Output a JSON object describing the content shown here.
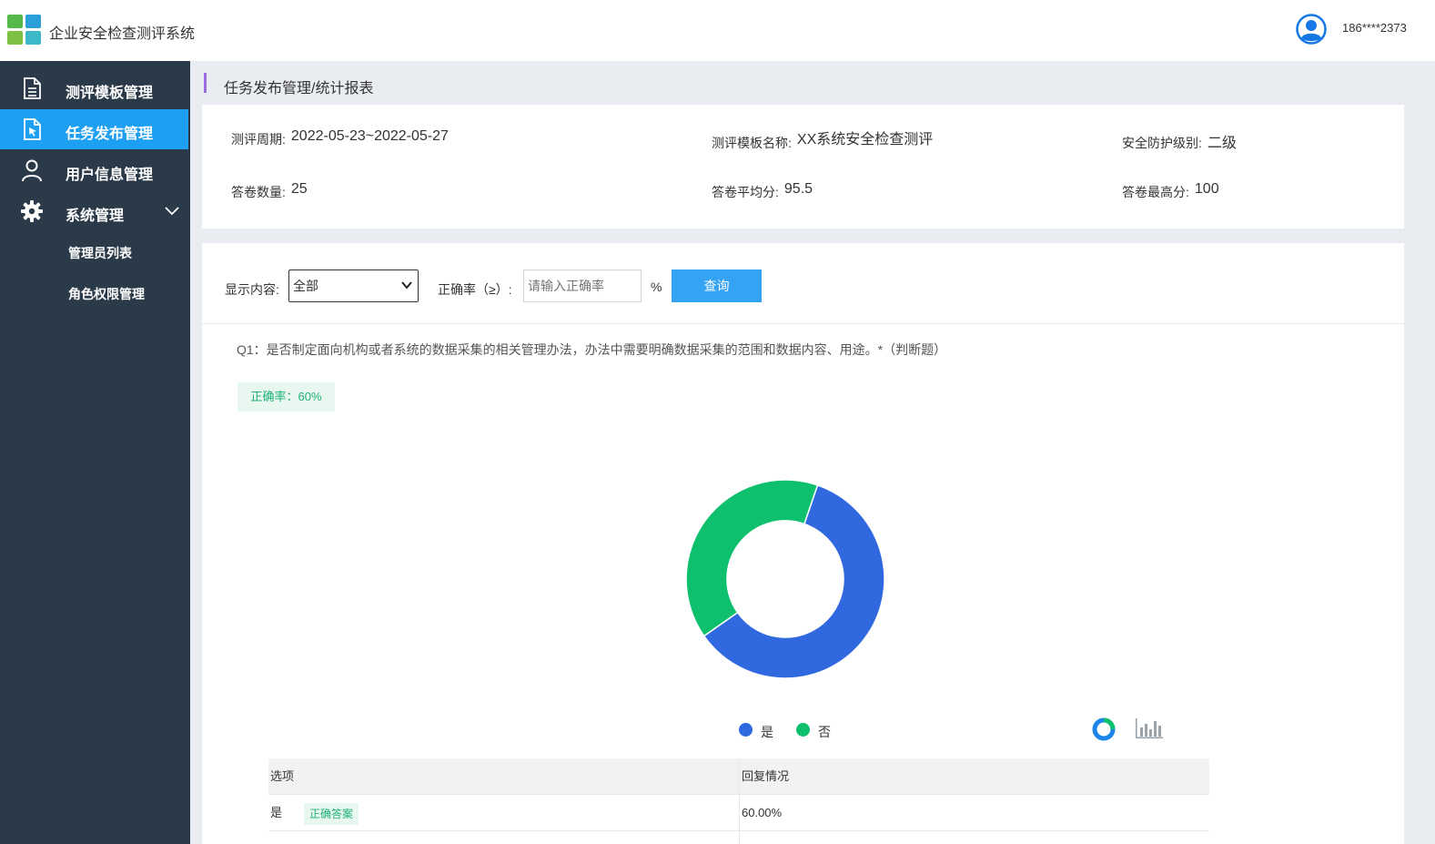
{
  "app": {
    "title": "企业安全检查测评系统"
  },
  "user": {
    "name": "186****2373"
  },
  "sidebar": {
    "items": [
      {
        "label": "测评模板管理"
      },
      {
        "label": "任务发布管理"
      },
      {
        "label": "用户信息管理"
      },
      {
        "label": "系统管理"
      }
    ],
    "sub_items": [
      {
        "label": "管理员列表"
      },
      {
        "label": "角色权限管理"
      }
    ]
  },
  "breadcrumb": {
    "text": "任务发布管理/统计报表"
  },
  "info": {
    "period": {
      "key": "测评周期:",
      "value": "2022-05-23~2022-05-27"
    },
    "template": {
      "key": "测评模板名称:",
      "value": "XX系统安全检查测评"
    },
    "level": {
      "key": "安全防护级别:",
      "value": "二级"
    },
    "count": {
      "key": "答卷数量:",
      "value": "25"
    },
    "avg": {
      "key": "答卷平均分:",
      "value": "95.5"
    },
    "max": {
      "key": "答卷最高分:",
      "value": "100"
    }
  },
  "filter": {
    "display_label": "显示内容:",
    "display_value": "全部",
    "rate_label": "正确率（≥）:",
    "rate_placeholder": "请输入正确率",
    "rate_unit": "%",
    "query_label": "查询"
  },
  "question": {
    "text": "Q1：是否制定面向机构或者系统的数据采集的相关管理办法，办法中需要明确数据采集的范围和数据内容、用途。*（判断题）",
    "accuracy": "正确率：60%"
  },
  "chart_data": {
    "type": "pie",
    "categories": [
      "是",
      "否"
    ],
    "values": [
      60,
      40
    ],
    "colors": [
      "#3068e0",
      "#0ec06e"
    ],
    "legend": "bottom-center"
  },
  "table": {
    "headers": [
      "选项",
      "回复情况"
    ],
    "rows": [
      {
        "option": "是",
        "tag": "正确答案",
        "reply": "60.00%"
      }
    ]
  }
}
